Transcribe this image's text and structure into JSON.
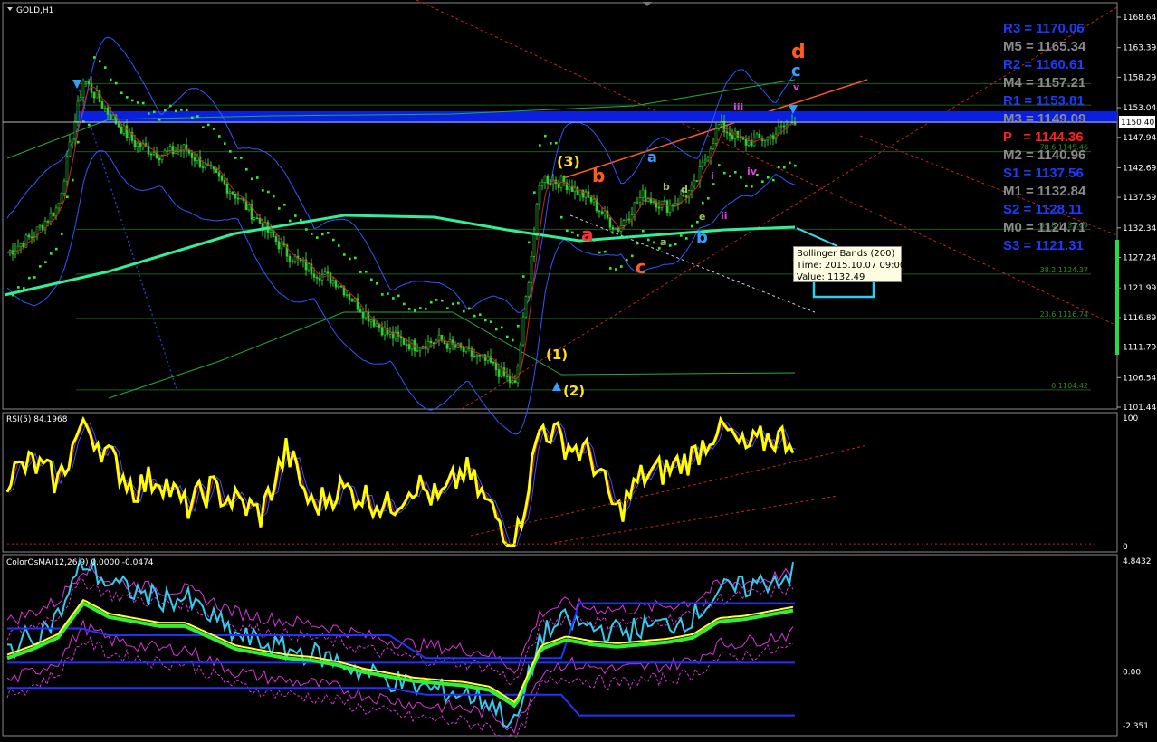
{
  "window": {
    "symbol_label": "GOLD,H1",
    "price_tag": "1150.40"
  },
  "colors": {
    "background": "#000000",
    "grid": "#1a5c1a",
    "candle": "#33cc33",
    "bollinger": "#3355ff",
    "ma200": "#33ee99",
    "pivot_blue": "#1a3cff",
    "pivot_gray": "#8a8a8a",
    "pivot_red": "#ff2020",
    "rsi_line": "#ffff00",
    "parabolic": "#33ee33"
  },
  "price_panel": {
    "tick_labels": [
      "1168.64",
      "1163.39",
      "1158.29",
      "1153.04",
      "1147.94",
      "1142.69",
      "1137.59",
      "1132.34",
      "1127.24",
      "1121.99",
      "1116.89",
      "1111.79",
      "1106.54",
      "1101.44"
    ],
    "fib_labels": [
      "78.6 1145.46",
      "61.8 1132.09",
      "38.2 1124.37",
      "23.6 1116.74",
      "0 1104.42"
    ],
    "pivot_levels": [
      {
        "label": "R3 = 1170.06",
        "color": "#1a3cff"
      },
      {
        "label": "M5 = 1165.34",
        "color": "#8a8a8a"
      },
      {
        "label": "R2 = 1160.61",
        "color": "#1a3cff"
      },
      {
        "label": "M4 = 1157.21",
        "color": "#8a8a8a"
      },
      {
        "label": "R1 = 1153.81",
        "color": "#1a3cff"
      },
      {
        "label": "M3 = 1149.09",
        "color": "#8a8a8a"
      },
      {
        "label": "P   = 1144.36",
        "color": "#ff2020"
      },
      {
        "label": "M2 = 1140.96",
        "color": "#8a8a8a"
      },
      {
        "label": "S1 = 1137.56",
        "color": "#1a3cff"
      },
      {
        "label": "M1 = 1132.84",
        "color": "#8a8a8a"
      },
      {
        "label": "S2 = 1128.11",
        "color": "#1a3cff"
      },
      {
        "label": "M0 = 1124.71",
        "color": "#8a8a8a"
      },
      {
        "label": "S3 = 1121.31",
        "color": "#1a3cff"
      }
    ],
    "wave_labels": [
      {
        "text": "d",
        "color": "#ff5a1f"
      },
      {
        "text": "c",
        "color": "#33a0ff"
      },
      {
        "text": "v",
        "color": "#e040e0"
      },
      {
        "text": "iii",
        "color": "#e040e0"
      },
      {
        "text": "(3)",
        "color": "#ffdd22"
      },
      {
        "text": "b",
        "color": "#ff5a1f"
      },
      {
        "text": "a",
        "color": "#33a0ff"
      },
      {
        "text": "b",
        "color": "#a0c060"
      },
      {
        "text": "d",
        "color": "#a0c060"
      },
      {
        "text": "i",
        "color": "#e040e0"
      },
      {
        "text": "iv",
        "color": "#e040e0"
      },
      {
        "text": "e",
        "color": "#a0c060"
      },
      {
        "text": "ii",
        "color": "#e040e0"
      },
      {
        "text": "a",
        "color": "#ff3030"
      },
      {
        "text": "b",
        "color": "#33a0ff"
      },
      {
        "text": "a",
        "color": "#a0c060"
      },
      {
        "text": "c",
        "color": "#ff5a1f"
      },
      {
        "text": "(1)",
        "color": "#ffdd22"
      },
      {
        "text": "(2)",
        "color": "#ffdd22"
      }
    ],
    "tooltip": {
      "line1": "Bollinger Bands (200)",
      "line2": "Time: 2015.10.07 09:00",
      "line3": "Value: 1132.49"
    }
  },
  "rsi_panel": {
    "label": "RSI(5) 84.1968",
    "tick_labels": [
      "100",
      "0"
    ]
  },
  "osma_panel": {
    "label": "ColorOsMA(12,26,9) 0.0000 -0.0474",
    "tick_labels": [
      "4.8432",
      "0.00",
      "-2.351"
    ]
  },
  "chart_data": [
    {
      "type": "line",
      "title": "GOLD,H1",
      "ylim": [
        1101.44,
        1168.64
      ],
      "series": [
        {
          "name": "",
          "values": [
            1128,
            1131,
            1136,
            1158,
            1152,
            1147,
            1145,
            1146,
            1142,
            1138,
            1133,
            1128,
            1125,
            1123,
            1118,
            1114,
            1112,
            1113,
            1111,
            1109,
            1105,
            1141,
            1140,
            1137,
            1132,
            1138,
            1136,
            1139,
            1150,
            1147,
            1148,
            1151
          ]
        }
      ]
    },
    {
      "type": "line",
      "title": "RSI(5) 84.1968",
      "ylim": [
        0,
        100
      ],
      "series": [
        {
          "name": "",
          "values": [
            55,
            65,
            50,
            98,
            70,
            45,
            55,
            30,
            45,
            35,
            25,
            75,
            30,
            45,
            40,
            30,
            50,
            35,
            60,
            30,
            2,
            95,
            80,
            70,
            25,
            55,
            60,
            70,
            95,
            75,
            85,
            84
          ]
        }
      ]
    },
    {
      "type": "line",
      "title": "ColorOsMA(12,26,9) 0.0000 -0.0474",
      "ylim": [
        -2.351,
        4.8432
      ],
      "series": [
        {
          "name": "",
          "values": [
            0.6,
            1.0,
            1.5,
            3.0,
            2.4,
            2.2,
            2.0,
            2.0,
            1.5,
            1.0,
            0.8,
            0.6,
            0.5,
            0.3,
            0.0,
            -0.2,
            -0.4,
            -0.5,
            -0.6,
            -0.8,
            -1.5,
            1.0,
            1.4,
            1.2,
            1.1,
            1.2,
            1.3,
            1.5,
            2.2,
            2.3,
            2.5,
            2.7
          ]
        }
      ]
    }
  ]
}
